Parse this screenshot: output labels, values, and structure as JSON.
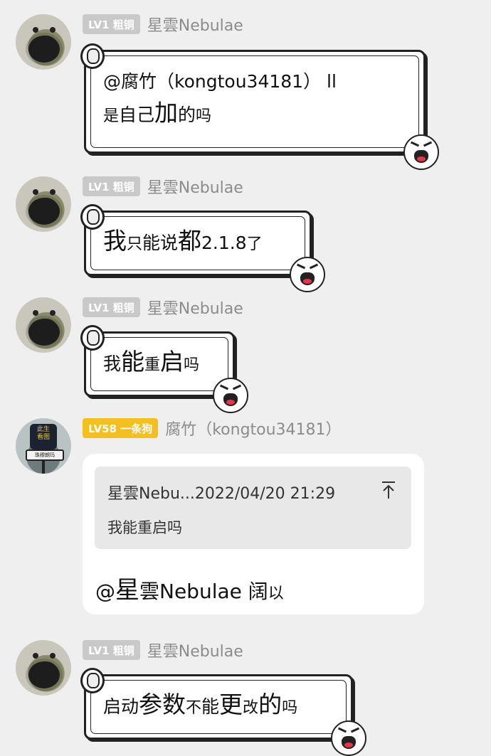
{
  "messages": [
    {
      "badge": "LV1 粗铜",
      "sender": "星雲Nebulae",
      "segments": [
        {
          "t": "@腐竹（kongtou34181） ll",
          "s": "n"
        },
        {
          "t": "\n",
          "s": "br"
        },
        {
          "t": "是",
          "s": "sm"
        },
        {
          "t": "自己",
          "s": "n"
        },
        {
          "t": "加",
          "s": "big"
        },
        {
          "t": "的",
          "s": "n"
        },
        {
          "t": "吗",
          "s": "sm"
        }
      ]
    },
    {
      "badge": "LV1 粗铜",
      "sender": "星雲Nebulae",
      "segments": [
        {
          "t": "我",
          "s": "big"
        },
        {
          "t": "只",
          "s": "sm"
        },
        {
          "t": "能说",
          "s": "n"
        },
        {
          "t": "都",
          "s": "big"
        },
        {
          "t": "2.1.8",
          "s": "n"
        },
        {
          "t": "了",
          "s": "sm"
        }
      ]
    },
    {
      "badge": "LV1 粗铜",
      "sender": "星雲Nebulae",
      "segments": [
        {
          "t": "我",
          "s": "n"
        },
        {
          "t": "能",
          "s": "big"
        },
        {
          "t": "重",
          "s": "sm"
        },
        {
          "t": "启",
          "s": "big"
        },
        {
          "t": "吗",
          "s": "sm"
        }
      ]
    },
    {
      "badge": "LV58 一条狗",
      "badge_color": "#f4c01f",
      "sender": "腐竹（kongtou34181）",
      "quote_head": "星雲Nebu...2022/04/20 21:29",
      "quote_body": "我能重启吗",
      "text_mention_a": "@",
      "text_mention_b": "星",
      "text_mention_c": "雲Nebulae ",
      "text_rest": "阔",
      "text_tail": "以"
    },
    {
      "badge": "LV1 粗铜",
      "sender": "星雲Nebulae",
      "segments": [
        {
          "t": "启动",
          "s": "n"
        },
        {
          "t": "参数",
          "s": "big"
        },
        {
          "t": "不",
          "s": "sm"
        },
        {
          "t": "能",
          "s": "n"
        },
        {
          "t": "更",
          "s": "big"
        },
        {
          "t": "改",
          "s": "sm"
        },
        {
          "t": "的",
          "s": "big"
        },
        {
          "t": "吗",
          "s": "sm"
        }
      ]
    }
  ],
  "colors": {
    "background": "#efefef",
    "badge_gray": "#c9c9c9",
    "badge_gold": "#f4c01f",
    "name": "#8c8c8c",
    "quote_bg": "#e8e8e8"
  },
  "icons": {
    "jump": "arrow-up-to-line-icon",
    "sticker": "rage-face-icon",
    "clip": "paper-roll-icon"
  }
}
